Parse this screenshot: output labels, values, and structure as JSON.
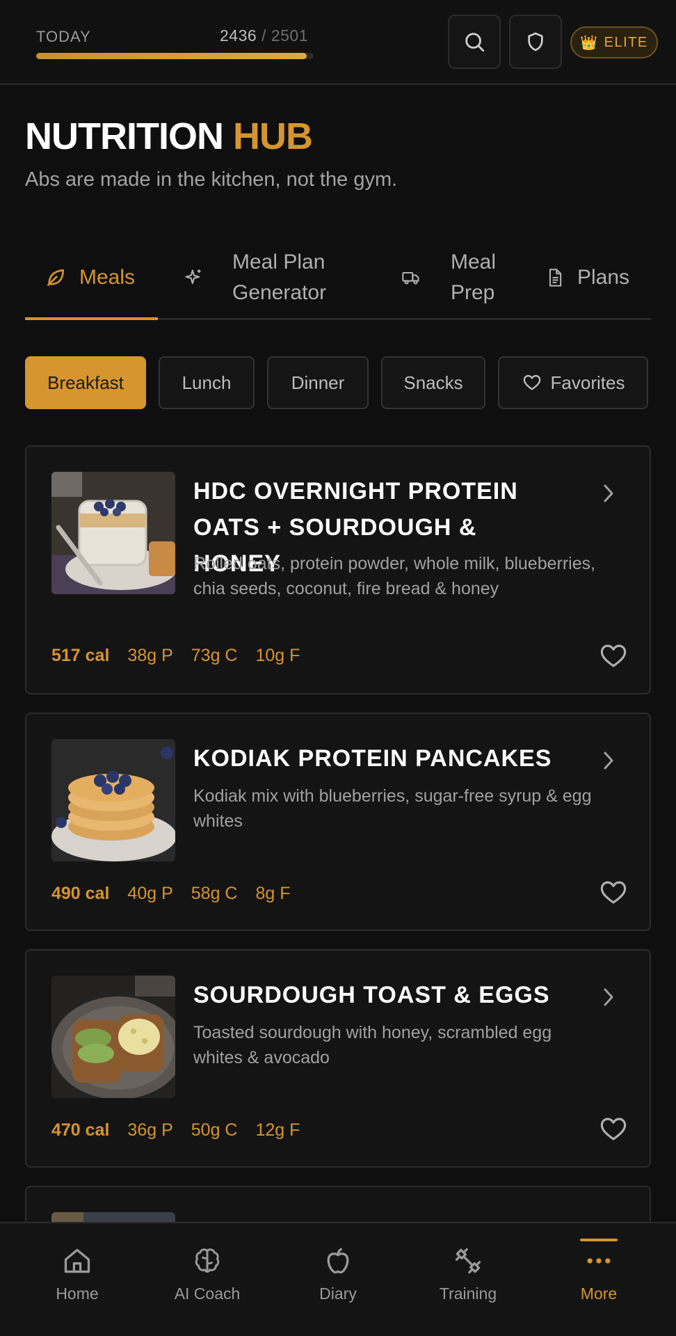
{
  "header": {
    "today_label": "TODAY",
    "calories_consumed": "2436",
    "calories_goal_text": "/ 2501",
    "progress_fraction": 0.974,
    "badge_label": "ELITE",
    "badge_icon": "crown-icon",
    "icons": [
      "search-icon",
      "shield-icon"
    ]
  },
  "page": {
    "title_main": "NUTRITION",
    "title_accent": "HUB",
    "subtitle": "Abs are made in the kitchen, not the gym."
  },
  "tabs": [
    {
      "label": "Meals",
      "icon": "leaf-icon",
      "active": true
    },
    {
      "label_line1": "Meal Plan",
      "label_line2": "Generator",
      "icon": "sparkles-icon"
    },
    {
      "label_line1": "Meal",
      "label_line2": "Prep",
      "icon": "truck-icon"
    },
    {
      "label": "Plans",
      "icon": "document-icon"
    }
  ],
  "filters": [
    {
      "label": "Breakfast",
      "active": true
    },
    {
      "label": "Lunch"
    },
    {
      "label": "Dinner"
    },
    {
      "label": "Snacks"
    },
    {
      "label": "Favorites",
      "icon": "heart-icon"
    }
  ],
  "meals": [
    {
      "title_line1": "HDC OVERNIGHT PROTEIN",
      "title_line2": "OATS + SOURDOUGH & HONEY",
      "description": "Rolled oats, protein powder, whole milk, blueberries, chia seeds, coconut, fire bread & honey",
      "calories": "517 cal",
      "protein": "38g P",
      "carbs": "73g C",
      "fat": "10g F"
    },
    {
      "title_line1": "KODIAK PROTEIN PANCAKES",
      "description": "Kodiak mix with blueberries, sugar-free syrup & egg whites",
      "calories": "490 cal",
      "protein": "40g P",
      "carbs": "58g C",
      "fat": "8g F"
    },
    {
      "title_line1": "SOURDOUGH TOAST & EGGS",
      "description": "Toasted sourdough with honey, scrambled egg whites & avocado",
      "calories": "470 cal",
      "protein": "36g P",
      "carbs": "50g C",
      "fat": "12g F"
    }
  ],
  "bottom_nav": [
    {
      "label": "Home",
      "icon": "home-icon"
    },
    {
      "label": "AI Coach",
      "icon": "brain-icon"
    },
    {
      "label": "Diary",
      "icon": "apple-icon"
    },
    {
      "label": "Training",
      "icon": "dumbbell-icon"
    },
    {
      "label": "More",
      "icon": "more-dots-icon",
      "active": true
    }
  ],
  "colors": {
    "accent": "#d6952f",
    "background": "#0f0f0f",
    "card": "#141414",
    "text_muted": "#a0a0a0"
  }
}
